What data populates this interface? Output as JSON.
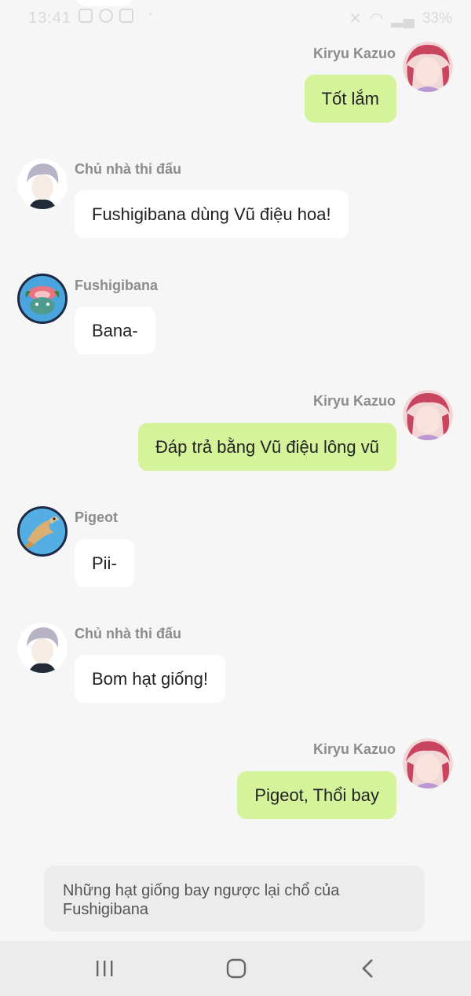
{
  "status_bar": {
    "time": "13:41",
    "battery": "33%"
  },
  "messages": [
    {
      "sender": "Kiryu Kazuo",
      "text": "Tốt lắm",
      "side": "out",
      "avatar": "kiryu-avatar"
    },
    {
      "sender": "Chủ nhà thi đấu",
      "text": "Fushigibana dùng Vũ điệu hoa!",
      "side": "in",
      "avatar": "gym-leader-avatar"
    },
    {
      "sender": "Fushigibana",
      "text": "Bana-",
      "side": "in",
      "avatar": "fushigibana-avatar"
    },
    {
      "sender": "Kiryu Kazuo",
      "text": "Đáp trả bằng Vũ điệu lông vũ",
      "side": "out",
      "avatar": "kiryu-avatar"
    },
    {
      "sender": "Pigeot",
      "text": "Pii-",
      "side": "in",
      "avatar": "pigeot-avatar"
    },
    {
      "sender": "Chủ nhà thi đấu",
      "text": "Bom hạt giống!",
      "side": "in",
      "avatar": "gym-leader-avatar"
    },
    {
      "sender": "Kiryu Kazuo",
      "text": "Pigeot, Thổi bay",
      "side": "out",
      "avatar": "kiryu-avatar"
    }
  ],
  "narration": "Những hạt giống bay ngược lại chổ của Fushigibana",
  "nav": {
    "recents_icon": "recents-icon",
    "home_icon": "home-icon",
    "back_icon": "back-icon"
  }
}
